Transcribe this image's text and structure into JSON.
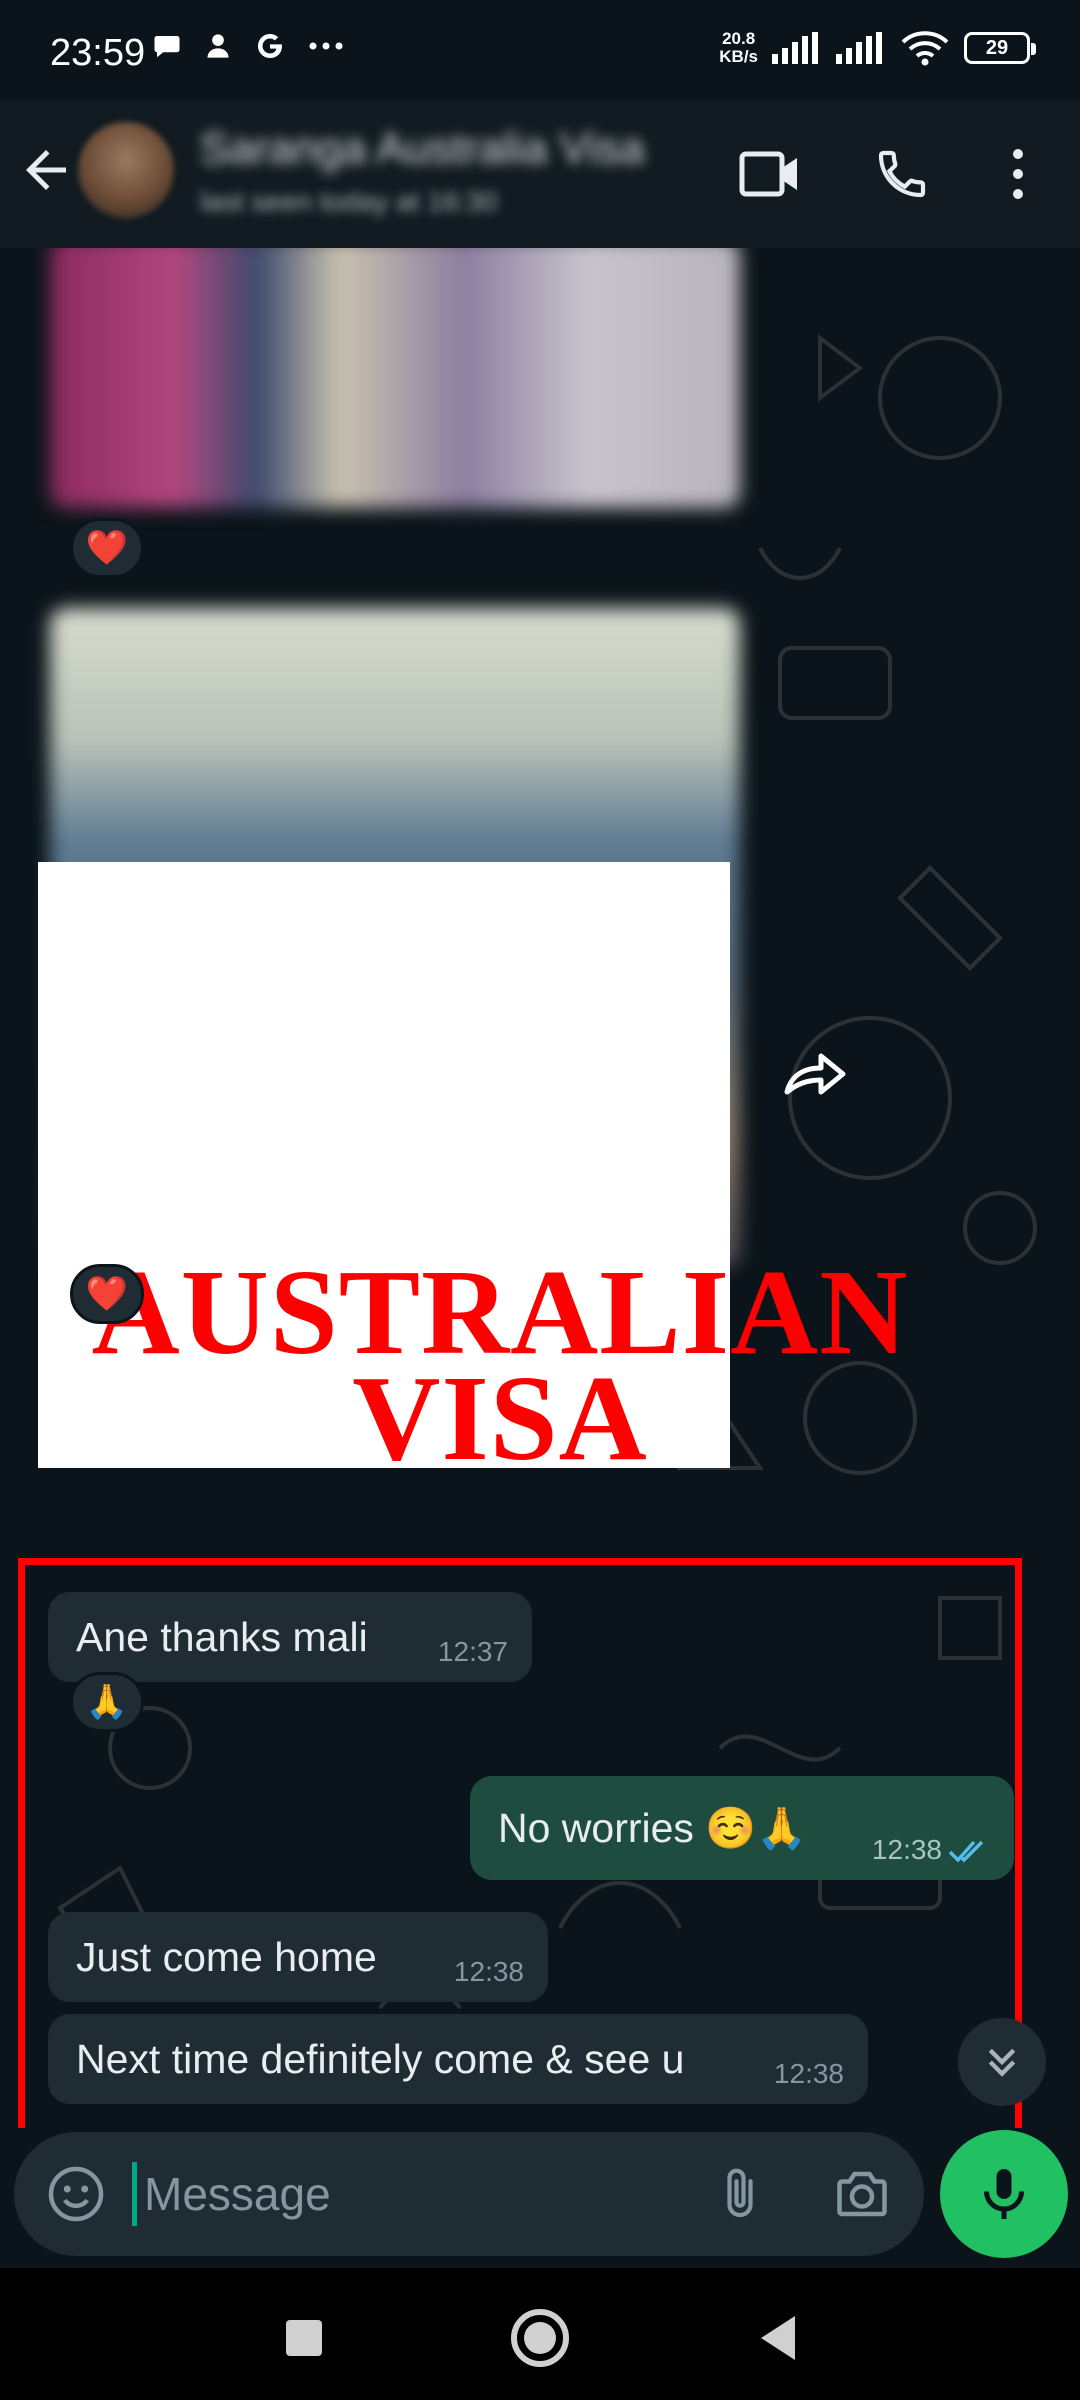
{
  "status_bar": {
    "time": "23:59",
    "left_icons": [
      "chat-bubble-icon",
      "person-icon",
      "google-g-icon",
      "more-dots-icon"
    ],
    "net_speed_value": "20.8",
    "net_speed_unit": "KB/s",
    "battery": "29"
  },
  "header": {
    "contact_name": "Saranga Australia Visa",
    "contact_status": "last seen today at 16:30",
    "icons": [
      "back-arrow-icon",
      "video-call-icon",
      "voice-call-icon",
      "overflow-menu-icon"
    ]
  },
  "overlay": {
    "line1": "AUSTRALIAN",
    "line2": "VISA"
  },
  "messages": [
    {
      "direction": "in",
      "text": "Ane thanks mali",
      "time": "12:37",
      "reaction": "🙏"
    },
    {
      "direction": "out",
      "text": "No worries ☺️🙏",
      "time": "12:38",
      "status": "read"
    },
    {
      "direction": "in",
      "text": "Just come home",
      "time": "12:38"
    },
    {
      "direction": "in",
      "text": "Next time definitely come & see u",
      "time": "12:38"
    }
  ],
  "media_reactions": [
    "❤️",
    "❤️"
  ],
  "composer": {
    "placeholder": "Message"
  },
  "colors": {
    "background": "#0b141a",
    "incoming_bubble": "#1f2c34",
    "outgoing_bubble": "#1e4d3f",
    "accent_green": "#21c063",
    "highlight_red": "#ff0000",
    "read_ticks": "#53bdeb"
  }
}
